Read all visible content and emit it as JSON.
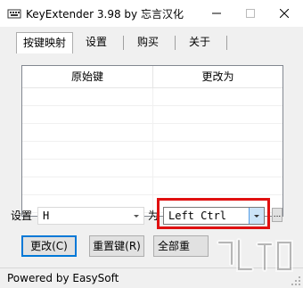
{
  "window": {
    "title": "KeyExtender 3.98 by 忘言汉化",
    "minimize_icon": "minimize-icon",
    "maximize_icon": "maximize-icon",
    "close_icon": "close-icon"
  },
  "tabs": [
    {
      "label": "按键映射",
      "active": true
    },
    {
      "label": "设置",
      "active": false
    },
    {
      "label": "购买",
      "active": false
    },
    {
      "label": "关于",
      "active": false
    }
  ],
  "mapping_table": {
    "columns": [
      "原始键",
      "更改为"
    ],
    "rows": []
  },
  "form": {
    "source_label": "设置",
    "source_value": "H",
    "target_label": "为",
    "target_value": "Left Ctrl",
    "more_button": "..."
  },
  "buttons": {
    "change": "更改(C)",
    "reset": "重置键(R)",
    "all": "全部重"
  },
  "status": {
    "text": "Powered by EasySoft"
  },
  "colors": {
    "highlight": "#e01010",
    "selection_accent": "#0078d7"
  }
}
